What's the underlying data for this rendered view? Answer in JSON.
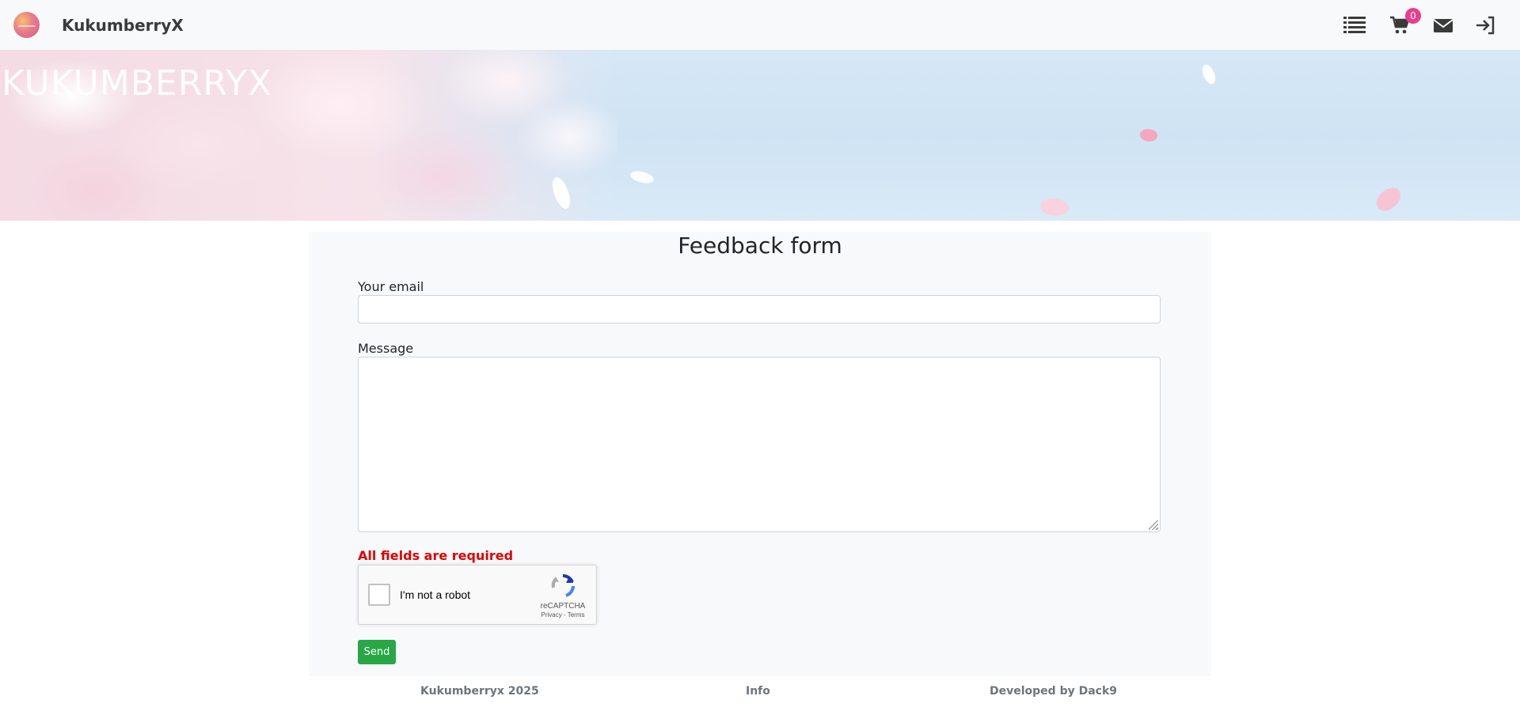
{
  "navbar": {
    "brand": "KukumberryX",
    "cart_count": "0",
    "icons": [
      "list-icon",
      "cart-icon",
      "mail-icon",
      "login-icon"
    ]
  },
  "hero": {
    "title": "KUKUMBERRYX"
  },
  "form": {
    "title": "Feedback form",
    "email_label": "Your email",
    "email_value": "",
    "message_label": "Message",
    "message_value": "",
    "required_notice": "All fields are required",
    "send_label": "Send"
  },
  "recaptcha": {
    "label": "I'm not a robot",
    "brand": "reCAPTCHA",
    "links": "Privacy - Terms"
  },
  "footer": {
    "copyright": "Kukumberryx 2025",
    "info": "Info",
    "developer": "Developed by Dack9"
  },
  "colors": {
    "navbar_bg": "#f8f9fa",
    "badge": "#e83e8c",
    "required": "#e00000",
    "send_button": "#28a745",
    "footer_text": "#6c757d"
  }
}
